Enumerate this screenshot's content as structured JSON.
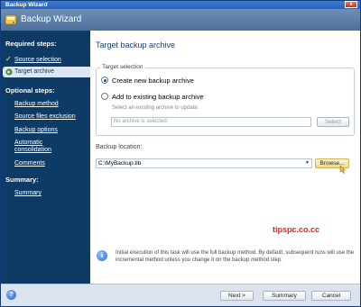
{
  "window": {
    "title": "Backup Wizard",
    "close_glyph": "x"
  },
  "header": {
    "title": "Backup Wizard",
    "icon": "backup-wizard-icon"
  },
  "sidebar": {
    "required_heading": "Required steps:",
    "required_items": [
      {
        "label": "Source selection",
        "state": "done"
      },
      {
        "label": "Target archive",
        "state": "active"
      }
    ],
    "optional_heading": "Optional steps:",
    "optional_items": [
      {
        "label": "Backup method"
      },
      {
        "label": "Source files exclusion"
      },
      {
        "label": "Backup options"
      },
      {
        "label": "Automatic consolidation"
      },
      {
        "label": "Comments"
      }
    ],
    "summary_heading": "Summary:",
    "summary_item": "Summary"
  },
  "content": {
    "title": "Target backup archive",
    "target_selection": {
      "legend": "Target selection",
      "option_new": "Create new backup archive",
      "option_existing": "Add to existing backup archive",
      "existing_hint": "Select an existing archive to update:",
      "archive_placeholder": "No archive is selected.",
      "select_button": "Select"
    },
    "location": {
      "label": "Backup location:",
      "value": "C:\\MyBackup.tib",
      "browse_button": "Browse..."
    },
    "info_text": "Initial execution of this task will use the full backup method. By default, subsequent runs will use the incremental method unless you change it on the backup method step."
  },
  "watermark": "tipspc.co.cc",
  "footer": {
    "next_button": "Next >",
    "summary_button": "Summary",
    "cancel_button": "Cancel"
  },
  "colors": {
    "sidebar": "#0e3b66",
    "header": "#5a7ba6",
    "title": "#1b3f6e",
    "watermark": "#e81f1f"
  }
}
